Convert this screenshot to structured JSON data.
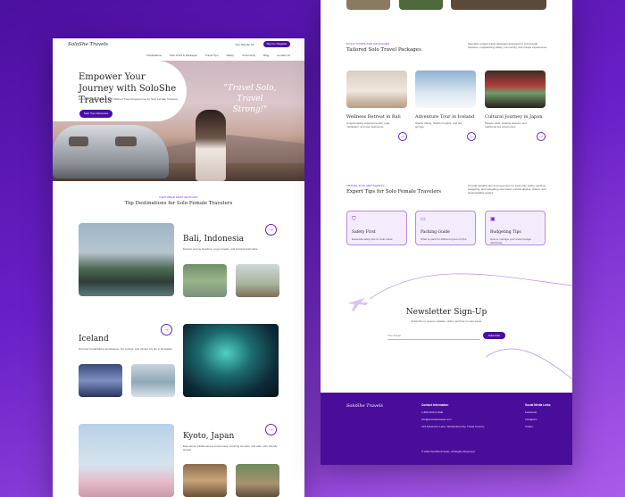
{
  "brand": "SoloShe Travels",
  "header": {
    "phone": "Your Wander 02",
    "cta": "Sign In / Register",
    "nav": [
      "Destinations",
      "Solo Tours & Packages",
      "Travel Tips",
      "Safety",
      "Community",
      "Blog",
      "Contact Us"
    ]
  },
  "hero": {
    "title": "Empower Your Journey with SoloShe Travels",
    "subtitle": "Discover Safe, Inspiring, and Tailored Travel Experiences for Solo Female Travelers",
    "cta": "Start Your Adventure",
    "quote": "\"Travel Solo, Travel Strong!\""
  },
  "destinations": {
    "eyebrow": "FEATURED DESTINATIONS",
    "title": "Top Destinations for Solo Female Travelers",
    "items": [
      {
        "name": "Bali, Indonesia",
        "desc": "Explore serene beaches, yoga retreats, and cultural landmarks."
      },
      {
        "name": "Iceland",
        "desc": "Discover breathtaking landscapes, hot springs, and vibrant city life in Reykjavik."
      },
      {
        "name": "Kyoto, Japan",
        "desc": "Experience traditional tea ceremonies, stunning temples, and safe, solo-friendly streets."
      }
    ],
    "arrow": "→"
  },
  "packages": {
    "eyebrow": "SOLO TOURS AND PACKAGES",
    "title": "Tailored Solo Travel Packages",
    "intro": "Specially curated travel packages designed for solo female travelers, emphasizing safety, community, and unique experiences.",
    "items": [
      {
        "name": "Wellness Retreat in Bali",
        "desc": "A rejuvenating experience with yoga, meditation, and spa treatments."
      },
      {
        "name": "Adventure Tour in Iceland",
        "desc": "Glacier hiking, Northern Lights, and hot springs."
      },
      {
        "name": "Cultural Journey in Japan",
        "desc": "Temple visits, cooking classes, and traditional tea ceremonies."
      }
    ]
  },
  "tips": {
    "eyebrow": "TRAVEL TIPS AND SAFETY",
    "title": "Expert Tips for Solo Female Travelers",
    "intro": "Provide valuable tips and resources for topics like safety, packing, budgeting, and navigating new travel, include articles, videos, and downloadable guides.",
    "items": [
      {
        "name": "Safety First",
        "desc": "Essential safety tips for solo travel.",
        "icon": "shield-icon"
      },
      {
        "name": "Packing Guide",
        "desc": "What to pack for different types of trips.",
        "icon": "suitcase-icon"
      },
      {
        "name": "Budgeting Tips",
        "desc": "How to manage your travel budget effectively.",
        "icon": "money-icon"
      }
    ]
  },
  "newsletter": {
    "title": "Newsletter Sign-Up",
    "subtitle": "Subscribe to receive updates, offers, and tips on solo travel.",
    "placeholder": "Your Email",
    "button": "Subscribe"
  },
  "footer": {
    "logo": "SoloShe Travels",
    "contact_title": "Contact Information",
    "contact": [
      "1-800-SOLO-SHE",
      "info@soloshetravels.com",
      "123 Adventure Lane, Wanderlust City, Travel Country"
    ],
    "social_title": "Social Media Links",
    "social": [
      "Facebook",
      "Instagram",
      "Twitter"
    ],
    "copyright": "© 2024 SoloSheTravels. All Rights Reserved."
  },
  "colors": {
    "accent": "#4a0fa0",
    "background": "#6a1fc7"
  }
}
